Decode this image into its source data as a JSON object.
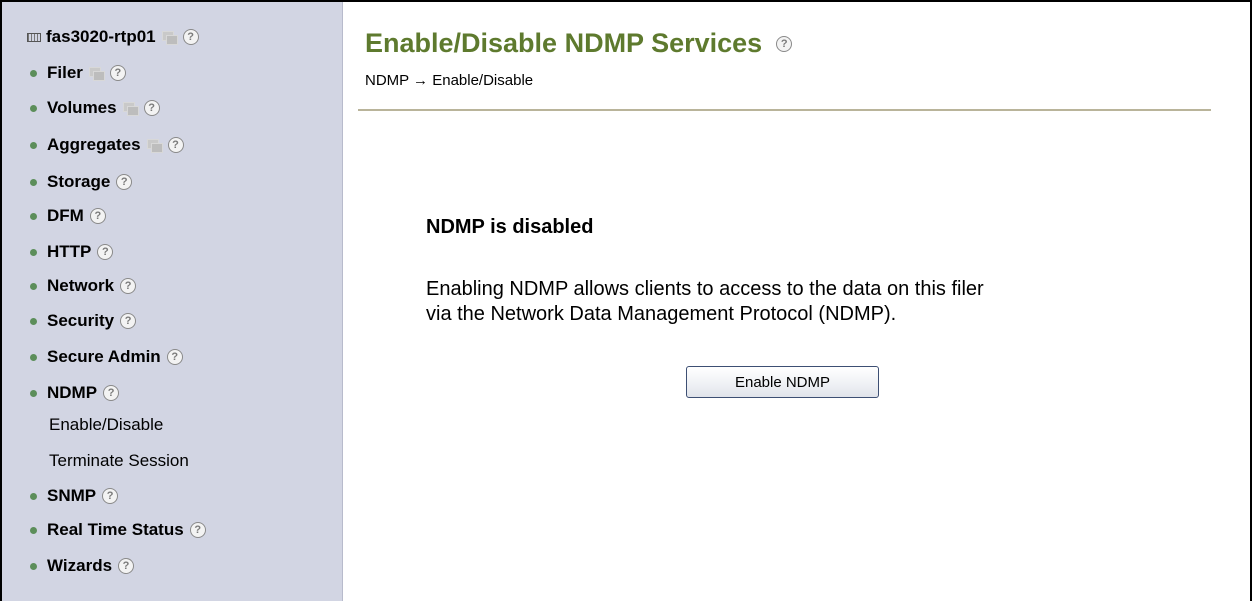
{
  "sidebar": {
    "host": "fas3020-rtp01",
    "items": [
      {
        "label": "Filer"
      },
      {
        "label": "Volumes"
      },
      {
        "label": "Aggregates"
      },
      {
        "label": "Storage"
      },
      {
        "label": "DFM"
      },
      {
        "label": "HTTP"
      },
      {
        "label": "Network"
      },
      {
        "label": "Security"
      },
      {
        "label": "Secure Admin"
      },
      {
        "label": "NDMP"
      },
      {
        "label": "Enable/Disable"
      },
      {
        "label": "Terminate Session"
      },
      {
        "label": "SNMP"
      },
      {
        "label": "Real Time Status"
      },
      {
        "label": "Wizards"
      }
    ],
    "help_glyph": "?",
    "bullet_color": "#5c8e5a",
    "background_color": "#d2d5e3"
  },
  "main": {
    "title": "Enable/Disable NDMP Services",
    "title_color": "#5e7a2e",
    "breadcrumb": "NDMP → Enable/Disable",
    "status": "NDMP is disabled",
    "description_line1": "Enabling NDMP allows clients to access to the data on this filer",
    "description_line2": "via the Network Data Management Protocol (NDMP).",
    "enable_button_label": "Enable NDMP"
  },
  "icons": {
    "host": "server-icon",
    "window": "new-window-icon",
    "help": "help-icon"
  }
}
